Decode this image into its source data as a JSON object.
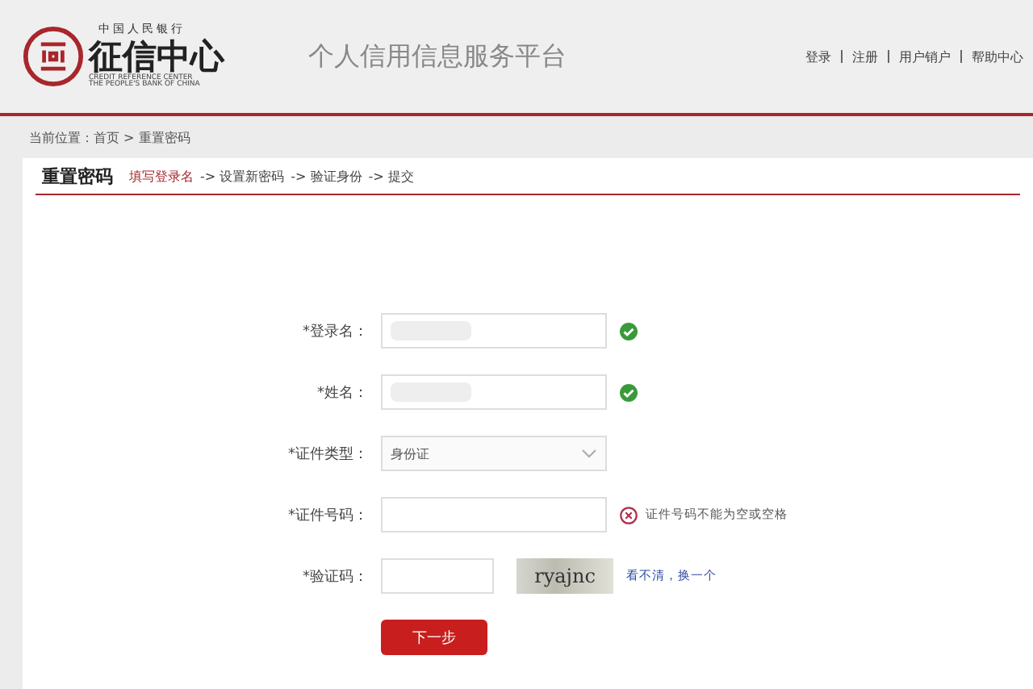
{
  "logo": {
    "top_line": "中国人民银行",
    "name": "征信中心",
    "english_1": "CREDIT REFERENCE CENTER",
    "english_2": "THE PEOPLE'S BANK OF CHINA"
  },
  "site_title": "个人信用信息服务平台",
  "nav": [
    "登录",
    "注册",
    "用户销户",
    "帮助中心"
  ],
  "breadcrumb": "当前位置：首页 > 重置密码",
  "panel": {
    "title": "重置密码",
    "steps": [
      {
        "label": "填写登录名",
        "selected": true
      },
      {
        "prefix": "->",
        "label": "设置新密码",
        "selected": false
      },
      {
        "prefix": "->",
        "label": "验证身份",
        "selected": false
      },
      {
        "prefix": "->",
        "label": "提交",
        "selected": false
      }
    ]
  },
  "form": [
    {
      "kind": "text",
      "label": "*登录名：",
      "blurred": true,
      "valid": true
    },
    {
      "kind": "text",
      "label": "*姓名：",
      "blurred": true,
      "valid": true
    },
    {
      "kind": "select",
      "label": "*证件类型：",
      "value": "身份证"
    },
    {
      "kind": "text",
      "label": "*证件号码：",
      "valid": false,
      "message": "证件号码不能为空或空格"
    },
    {
      "kind": "captcha",
      "label": "*验证码：",
      "captcha_text": "ryajnc",
      "refresh_link": "看不清，换一个"
    }
  ],
  "submit": "下一步"
}
